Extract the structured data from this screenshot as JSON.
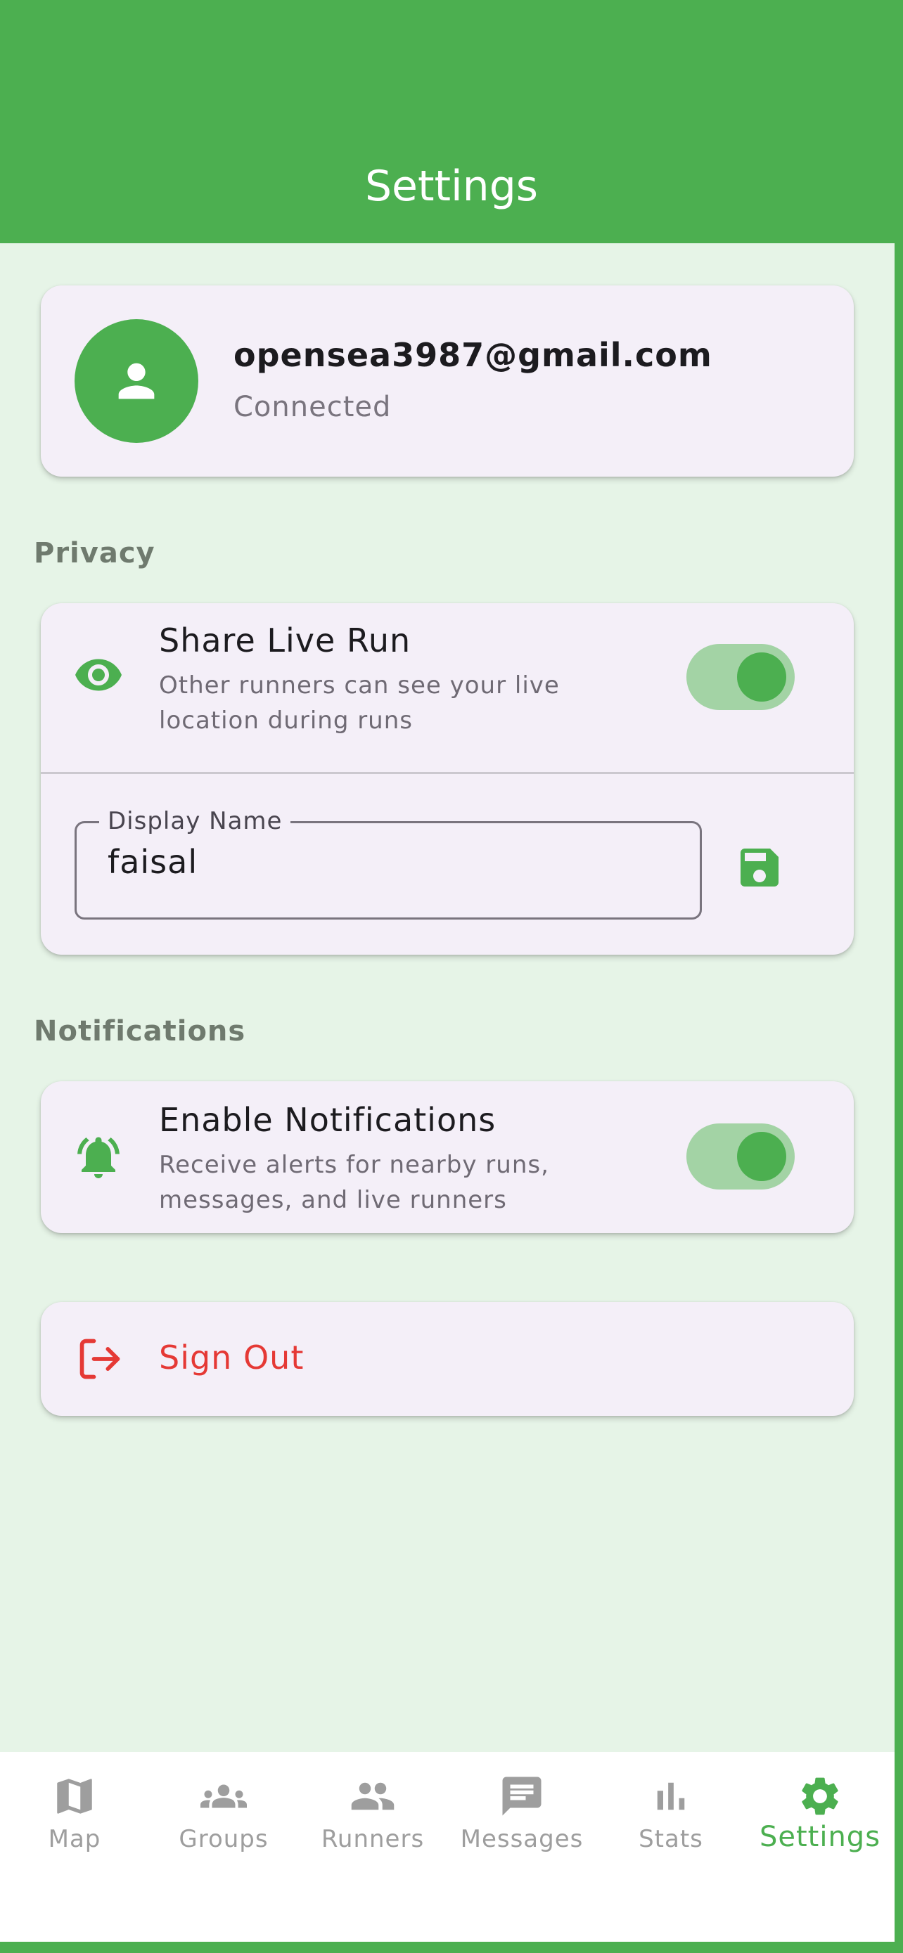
{
  "appbar": {
    "title": "Settings"
  },
  "account": {
    "email": "opensea3987@gmail.com",
    "status": "Connected"
  },
  "privacy": {
    "header": "Privacy",
    "share_live_run": {
      "title": "Share Live Run",
      "subtitle": "Other runners can see your live location during runs",
      "enabled": true
    },
    "display_name": {
      "label": "Display Name",
      "value": "faisal"
    }
  },
  "notifications": {
    "header": "Notifications",
    "enable": {
      "title": "Enable Notifications",
      "subtitle": "Receive alerts for nearby runs, messages, and live runners",
      "enabled": true
    }
  },
  "sign_out": {
    "label": "Sign Out"
  },
  "nav": {
    "items": [
      {
        "label": "Map",
        "icon": "map-icon"
      },
      {
        "label": "Groups",
        "icon": "groups-icon"
      },
      {
        "label": "Runners",
        "icon": "people-icon"
      },
      {
        "label": "Messages",
        "icon": "message-icon"
      },
      {
        "label": "Stats",
        "icon": "bar-chart-icon"
      },
      {
        "label": "Settings",
        "icon": "gear-icon"
      }
    ],
    "active": "Settings"
  },
  "colors": {
    "primary": "#4caf50",
    "background": "#e6f4e7",
    "card": "#f4eff8",
    "danger": "#e53935",
    "nav_inactive": "#9e9e9e"
  }
}
